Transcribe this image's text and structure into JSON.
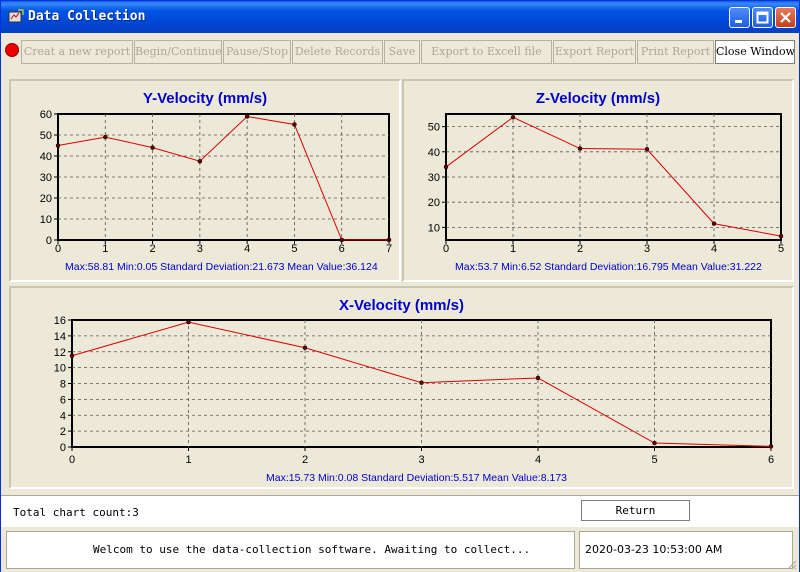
{
  "window": {
    "title": "Data Collection"
  },
  "toolbar": {
    "buttons": [
      "Creat a new report",
      "Begin/Continue",
      "Pause/Stop",
      "Delete Records",
      "Save",
      "Export to Excell file",
      "Export Report",
      "Print Report",
      "Close Window"
    ]
  },
  "colors": {
    "title_text": "#0000cc",
    "line": "#dd0000",
    "stats_text": "#0000cc"
  },
  "chart_data": [
    {
      "type": "line",
      "title": "Y-Velocity (mm/s)",
      "x": [
        0,
        1,
        2,
        3,
        4,
        5,
        6,
        7
      ],
      "values": [
        45,
        49,
        44,
        37.5,
        58.81,
        55,
        0.05,
        0.05
      ],
      "xlim": [
        0,
        7
      ],
      "ylim": [
        0,
        60
      ],
      "yticks": [
        0,
        10,
        20,
        30,
        40,
        50,
        60
      ],
      "grid": true,
      "stats": "Max:58.81  Min:0.05 Standard Deviation:21.673 Mean Value:36.124"
    },
    {
      "type": "line",
      "title": "Z-Velocity (mm/s)",
      "x": [
        0,
        1,
        2,
        3,
        4,
        5
      ],
      "values": [
        34,
        53.7,
        41.3,
        41,
        11.5,
        6.52
      ],
      "xlim": [
        0,
        5
      ],
      "ylim": [
        5,
        55
      ],
      "yticks": [
        10,
        20,
        30,
        40,
        50
      ],
      "grid": true,
      "stats": "Max:53.7  Min:6.52 Standard Deviation:16.795 Mean Value:31.222"
    },
    {
      "type": "line",
      "title": "X-Velocity (mm/s)",
      "x": [
        0,
        1,
        2,
        3,
        4,
        5,
        6
      ],
      "values": [
        11.5,
        15.73,
        12.5,
        8.1,
        8.7,
        0.5,
        0.08
      ],
      "xlim": [
        0,
        6
      ],
      "ylim": [
        0,
        16
      ],
      "yticks": [
        0,
        2,
        4,
        6,
        8,
        10,
        12,
        14,
        16
      ],
      "grid": true,
      "stats": "Max:15.73  Min:0.08 Standard Deviation:5.517 Mean Value:8.173"
    }
  ],
  "footer": {
    "count_label": "Total chart count:3",
    "return_label": "Return",
    "status_message": "Welcom to use the data-collection software. Awaiting to collect...",
    "timestamp": "2020-03-23 10:53:00 AM"
  }
}
